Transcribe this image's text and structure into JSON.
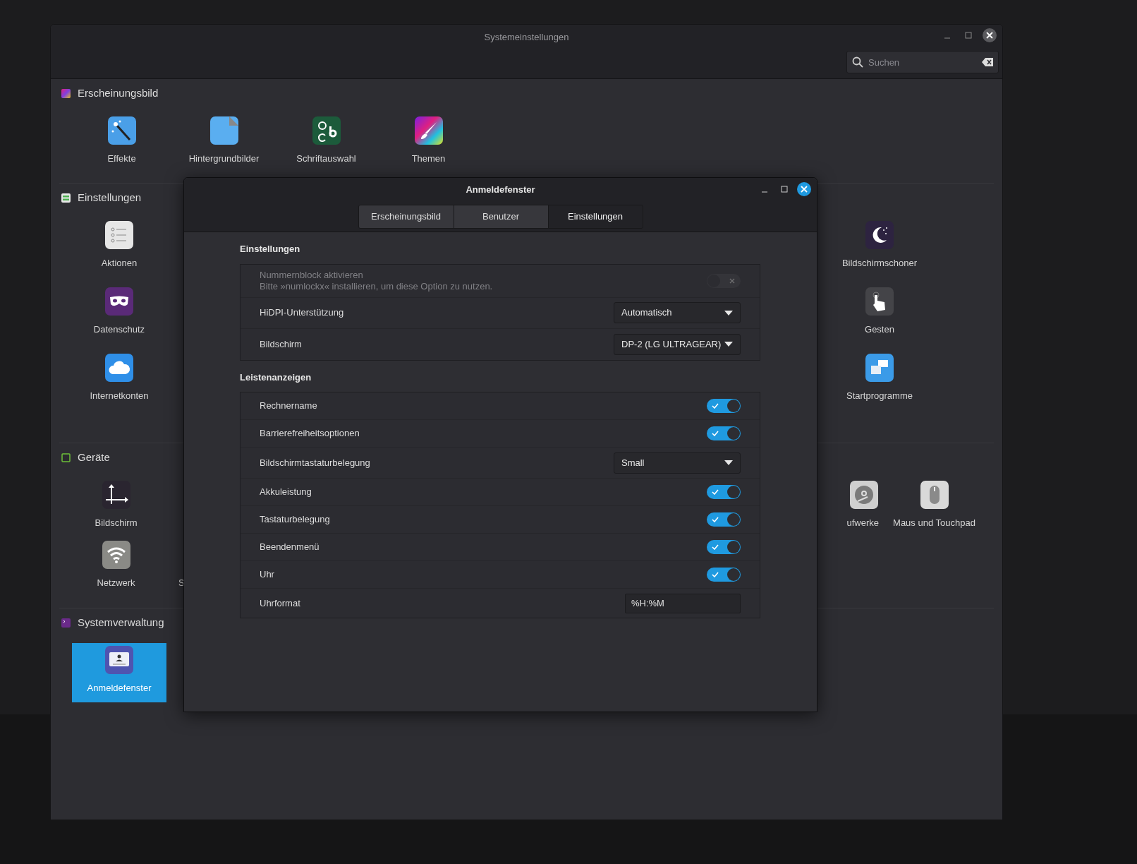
{
  "window": {
    "title": "Systemeinstellungen"
  },
  "search": {
    "placeholder": "Suchen"
  },
  "sections": [
    {
      "title": "Erscheinungsbild",
      "items": [
        {
          "label": "Effekte",
          "selected": false
        },
        {
          "label": "Hintergrundbilder",
          "selected": false
        },
        {
          "label": "Schriftauswahl",
          "selected": false
        },
        {
          "label": "Themen",
          "selected": false
        }
      ]
    },
    {
      "title": "Einstellungen",
      "items": [
        {
          "label": "Aktionen",
          "selected": false
        },
        {
          "label": "Bildschirmschoner",
          "selected": false
        },
        {
          "label": "Datenschutz",
          "selected": false
        },
        {
          "label": "Gesten",
          "selected": false
        },
        {
          "label": "Internetkonten",
          "selected": false
        },
        {
          "label": "Startprogramme",
          "selected": false
        }
      ]
    },
    {
      "title": "Geräte",
      "items": [
        {
          "label": "Bildschirm",
          "selected": false
        },
        {
          "label": "ufwerke",
          "selected": false
        },
        {
          "label": "Maus und Touchpad",
          "selected": false
        },
        {
          "label": "Netzwerk",
          "selected": false
        },
        {
          "label": "S",
          "selected": false
        }
      ]
    },
    {
      "title": "Systemverwaltung",
      "items": [
        {
          "label": "Anmeldefenster",
          "selected": true
        }
      ]
    }
  ],
  "dialog": {
    "title": "Anmeldefenster",
    "tabs": [
      {
        "label": "Erscheinungsbild",
        "selected": false
      },
      {
        "label": "Benutzer",
        "selected": false
      },
      {
        "label": "Einstellungen",
        "selected": true
      }
    ],
    "groups": [
      {
        "title": "Einstellungen",
        "rows": [
          {
            "kind": "switch",
            "label": "Nummernblock aktivieren",
            "description": "Bitte »numlockx« installieren, um diese Option zu nutzen.",
            "on": false,
            "disabled": true
          },
          {
            "kind": "dropdown",
            "label": "HiDPI-Unterstützung",
            "value": "Automatisch"
          },
          {
            "kind": "dropdown",
            "label": "Bildschirm",
            "value": "DP-2 (LG ULTRAGEAR)"
          }
        ]
      },
      {
        "title": "Leistenanzeigen",
        "rows": [
          {
            "kind": "switch",
            "label": "Rechnername",
            "on": true,
            "disabled": false
          },
          {
            "kind": "switch",
            "label": "Barrierefreiheitsoptionen",
            "on": true,
            "disabled": false
          },
          {
            "kind": "dropdown",
            "label": "Bildschirmtastaturbelegung",
            "value": "Small"
          },
          {
            "kind": "switch",
            "label": "Akkuleistung",
            "on": true,
            "disabled": false
          },
          {
            "kind": "switch",
            "label": "Tastaturbelegung",
            "on": true,
            "disabled": false
          },
          {
            "kind": "switch",
            "label": "Beendenmenü",
            "on": true,
            "disabled": false
          },
          {
            "kind": "switch",
            "label": "Uhr",
            "on": true,
            "disabled": false
          },
          {
            "kind": "entry",
            "label": "Uhrformat",
            "value": "%H:%M"
          }
        ]
      }
    ]
  }
}
